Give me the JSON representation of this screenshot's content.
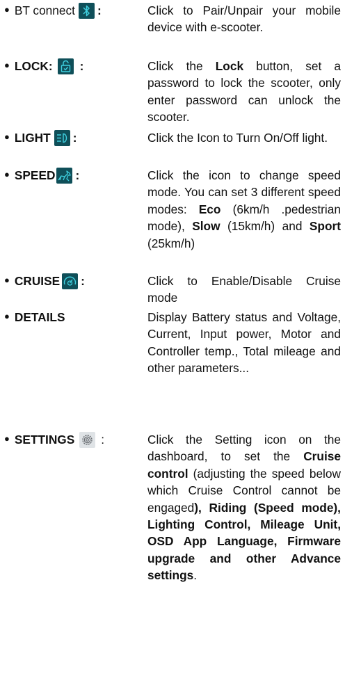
{
  "items": [
    {
      "term_plain": "BT connect",
      "term_bold": "",
      "icon": "bluetooth-icon",
      "colon": ":",
      "desc": [
        {
          "t": "Click to Pair/Unpair your mobile device with e-scooter.",
          "b": false
        }
      ]
    },
    {
      "term_plain": "",
      "term_bold": "LOCK",
      "icon": "lock-icon",
      "colon": ":",
      "desc": [
        {
          "t": "Click the ",
          "b": false
        },
        {
          "t": "Lock",
          "b": true
        },
        {
          "t": " button, set a password to lock the scooter, only enter password can unlock the scooter.",
          "b": false
        }
      ]
    },
    {
      "term_plain": "",
      "term_bold": "LIGHT",
      "icon": "headlight-icon",
      "colon": ":",
      "desc": [
        {
          "t": "Click the Icon to Turn On/Off light.",
          "b": false
        }
      ]
    },
    {
      "term_plain": "",
      "term_bold": "SPEED",
      "icon": "horse-speed-icon",
      "colon": ":",
      "desc": [
        {
          "t": "Click the icon to change speed mode. You can set 3 different speed modes: ",
          "b": false
        },
        {
          "t": "Eco",
          "b": true
        },
        {
          "t": " (6km/h .pedestrian mode), ",
          "b": false
        },
        {
          "t": "Slow",
          "b": true
        },
        {
          "t": " (15km/h) and ",
          "b": false
        },
        {
          "t": "Sport",
          "b": true
        },
        {
          "t": " (25km/h)",
          "b": false
        }
      ]
    },
    {
      "term_plain": "",
      "term_bold": "CRUISE",
      "icon": "cruise-gauge-icon",
      "colon": ":",
      "desc": [
        {
          "t": "Click to Enable/Disable Cruise mode",
          "b": false
        }
      ]
    },
    {
      "term_plain": "",
      "term_bold": "DETAILS",
      "icon": "",
      "colon": "",
      "desc": [
        {
          "t": "Display Battery status and Voltage, Current, Input power, Motor and Controller temp., Total mileage and other parameters...",
          "b": false
        }
      ]
    },
    {
      "term_plain": "",
      "term_bold": "SETTINGS",
      "icon": "settings-gear-icon",
      "colon": ":",
      "desc": [
        {
          "t": "Click the Setting icon on the dashboard, to set the ",
          "b": false
        },
        {
          "t": "Cruise control",
          "b": true
        },
        {
          "t": " (adjusting the speed below which Cruise Control cannot be engaged",
          "b": false
        },
        {
          "t": "), Riding (Speed mode), Lighting Control, Mileage Unit, OSD App Language, Firmware upgrade and other Advance settings",
          "b": true
        },
        {
          "t": ".",
          "b": false
        }
      ]
    }
  ],
  "colors": {
    "icon_bg": "#0f4f59",
    "icon_fg": "#3fd0df",
    "text": "#111111"
  }
}
